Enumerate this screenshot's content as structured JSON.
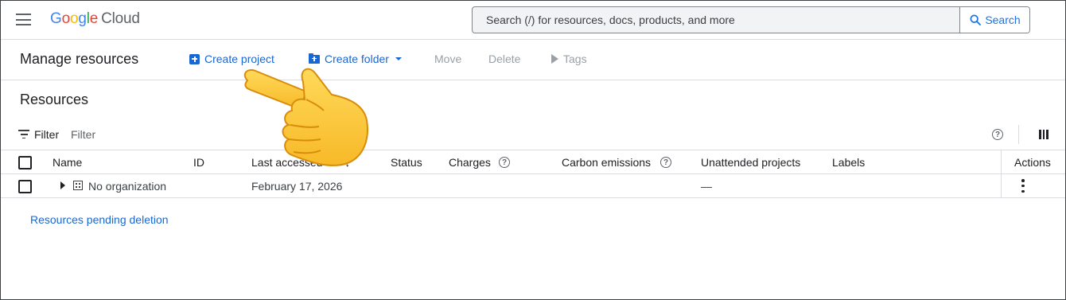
{
  "header": {
    "menu_icon": "hamburger-menu-icon",
    "logo": {
      "google": [
        "G",
        "o",
        "o",
        "g",
        "l",
        "e"
      ],
      "product": "Cloud"
    },
    "search": {
      "placeholder": "Search (/) for resources, docs, products, and more",
      "button_label": "Search",
      "icon": "search-icon"
    }
  },
  "toolbar": {
    "title": "Manage resources",
    "create_project": "Create project",
    "create_folder": "Create folder",
    "move": "Move",
    "delete": "Delete",
    "tags": "Tags"
  },
  "resources": {
    "title": "Resources",
    "filter_label": "Filter",
    "filter_placeholder": "Filter",
    "help_glyph": "?"
  },
  "table": {
    "columns": {
      "name": "Name",
      "id": "ID",
      "last_accessed": "Last accessed",
      "status": "Status",
      "charges": "Charges",
      "carbon": "Carbon emissions",
      "unattended": "Unattended projects",
      "labels": "Labels",
      "actions": "Actions"
    },
    "sort_glyph": "↓",
    "rows": [
      {
        "name": "No organization",
        "id": "",
        "last_accessed": "February 17, 2026",
        "status": "",
        "charges": "",
        "carbon": "",
        "unattended": "—",
        "labels": ""
      }
    ]
  },
  "footer_link": "Resources pending deletion",
  "colors": {
    "accent": "#1967d2",
    "disabled": "#9aa0a6",
    "border": "#dadce0"
  }
}
